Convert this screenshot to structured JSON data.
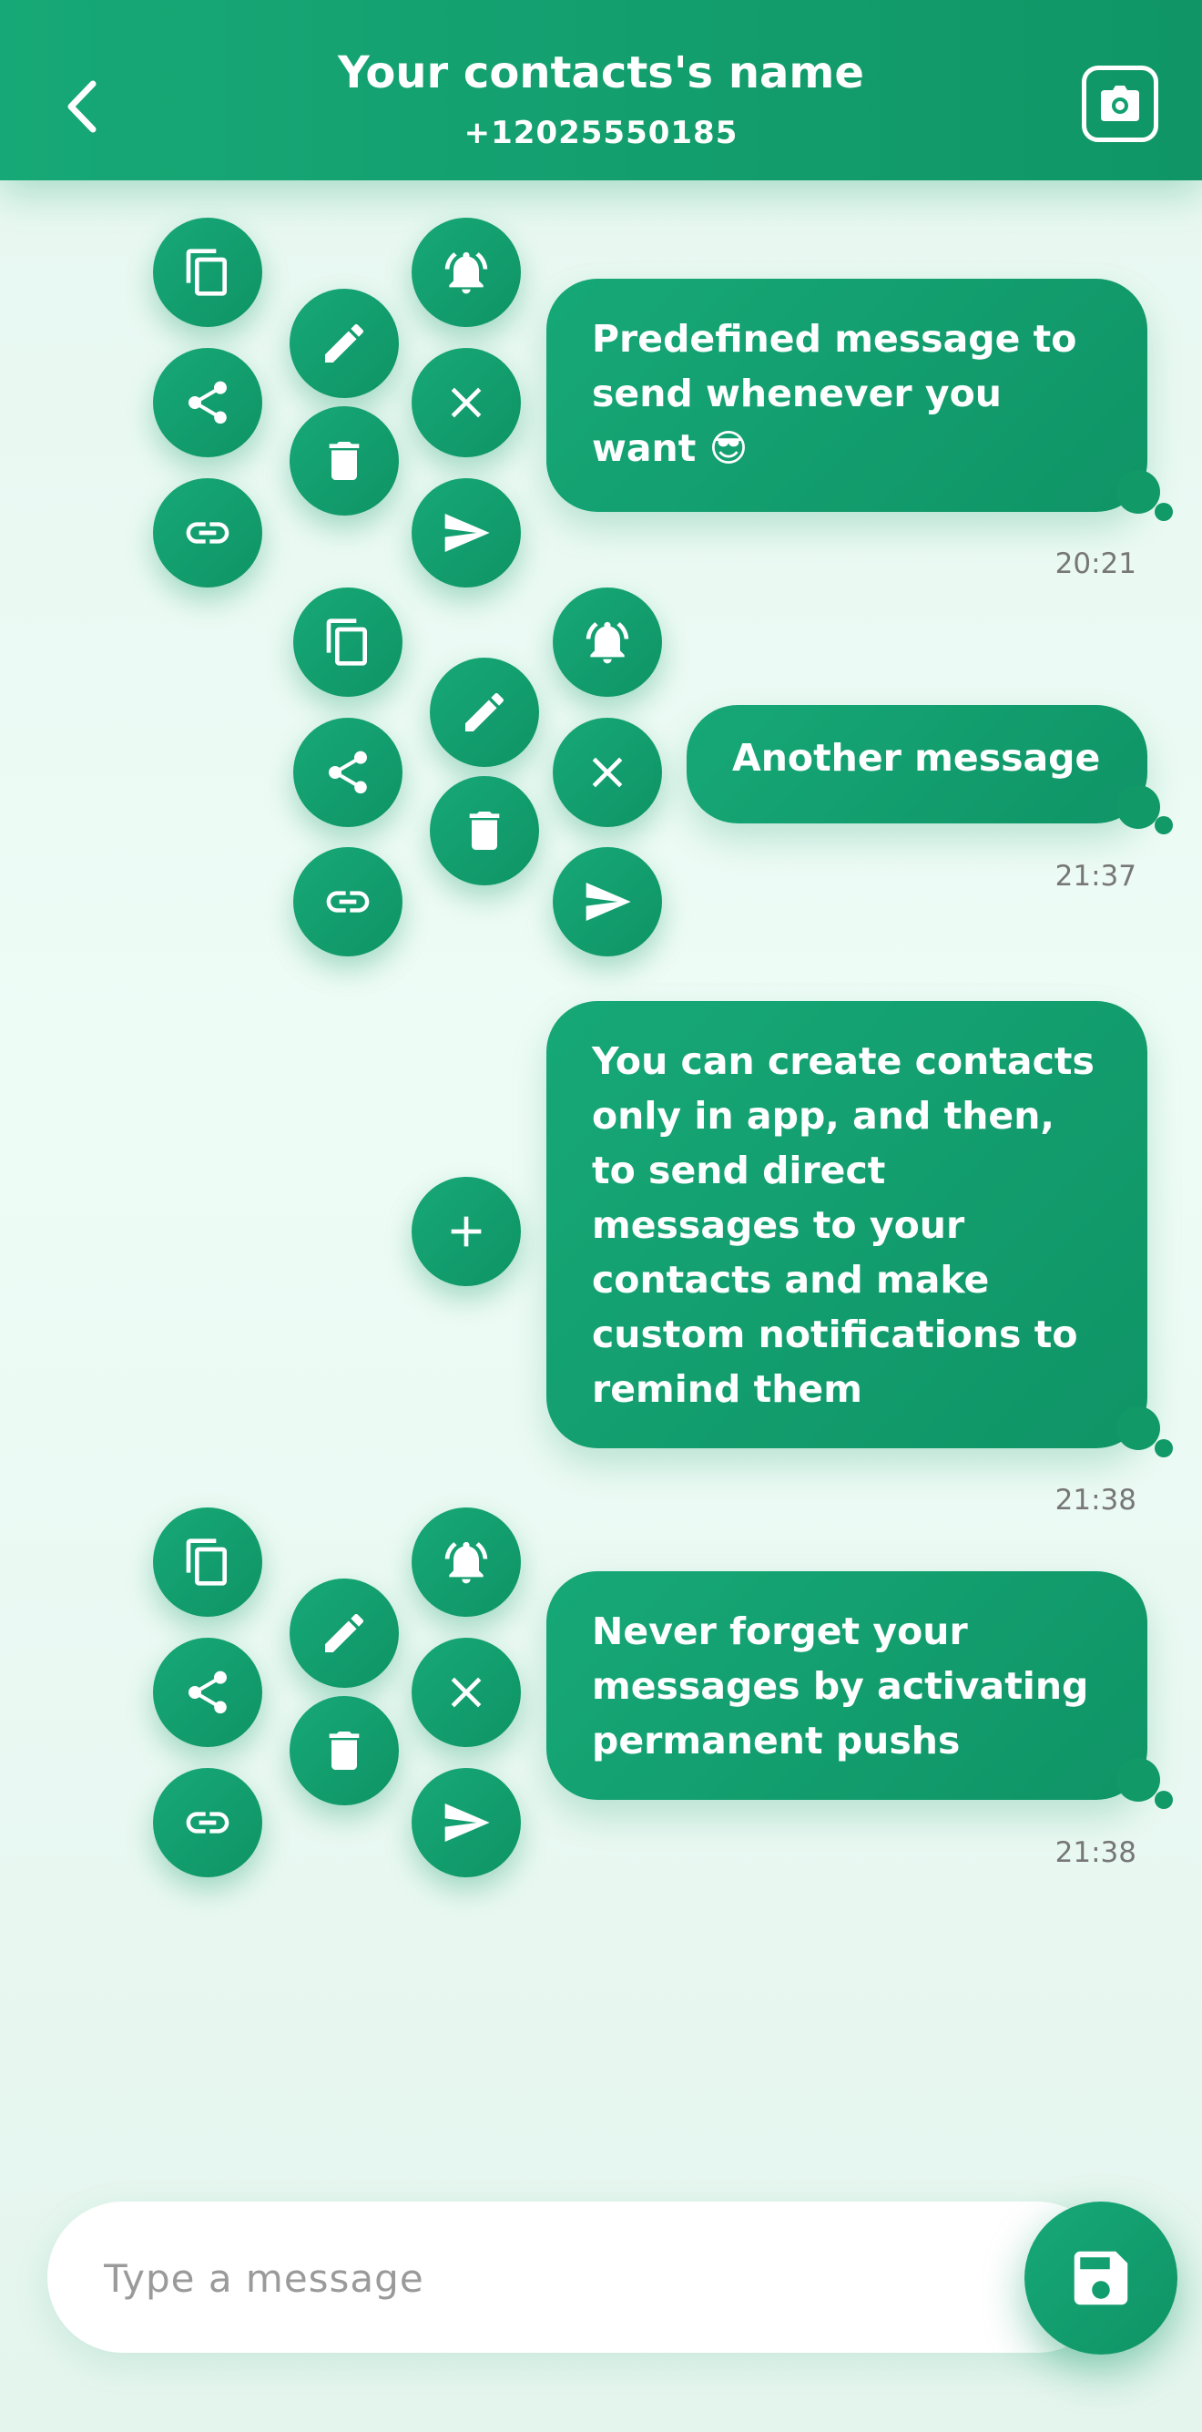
{
  "header": {
    "title": "Your contacts's name",
    "subtitle": "+12025550185",
    "back_icon": "chevron-left-icon",
    "camera_icon": "camera-icon"
  },
  "messages": [
    {
      "text": "Predefined message to send whenever you want 😎",
      "time": "20:21",
      "actions_expanded": true
    },
    {
      "text": "Another message",
      "time": "21:37",
      "actions_expanded": true
    },
    {
      "text": "You can create contacts only in app, and then, to send direct messages to your contacts and make custom notifications to remind them",
      "time": "21:38",
      "actions_expanded": false
    },
    {
      "text": "Never forget your messages by activating permanent pushs",
      "time": "21:38",
      "actions_expanded": true
    }
  ],
  "actions": [
    "copy",
    "share",
    "link",
    "edit",
    "delete",
    "notification",
    "close",
    "send"
  ],
  "input": {
    "placeholder": "Type a message",
    "value": ""
  },
  "save_icon": "save-icon",
  "colors": {
    "accent": "#17a877",
    "accent_dark": "#0f9466",
    "background": "#e8f8f1"
  }
}
